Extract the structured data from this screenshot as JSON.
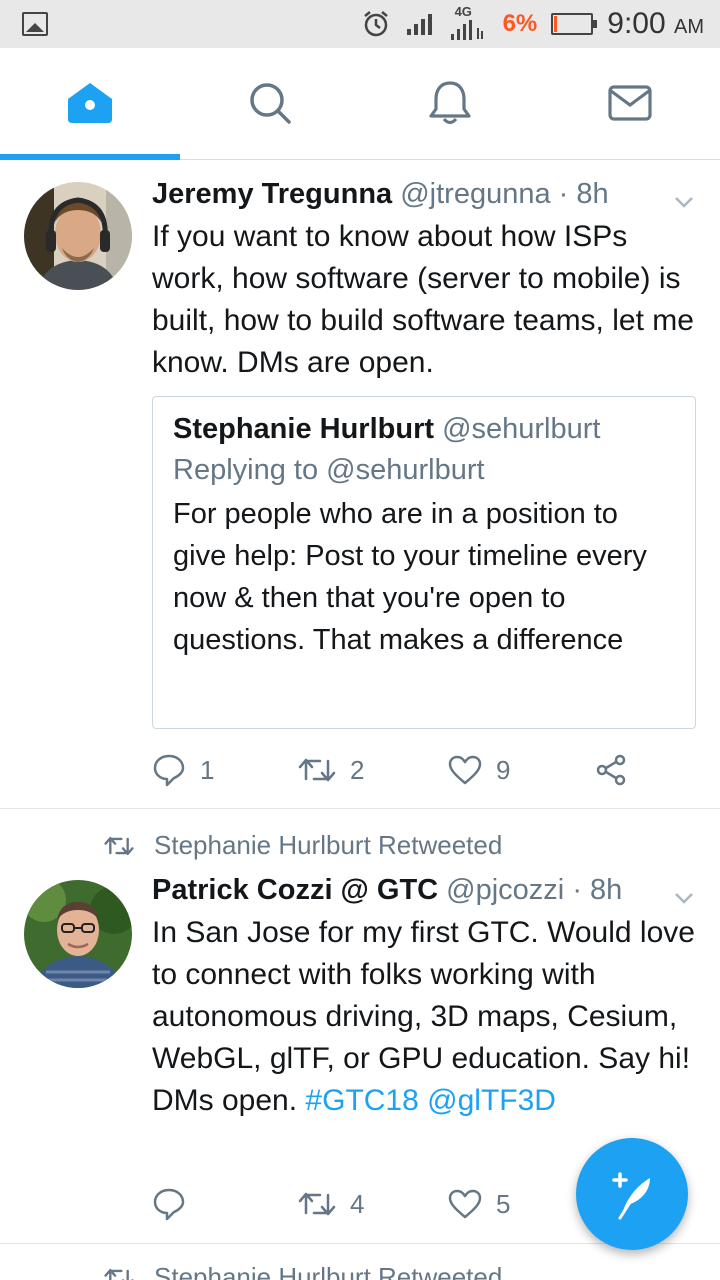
{
  "status_bar": {
    "network": "4G",
    "battery": "6%",
    "time": "9:00",
    "ampm": "AM"
  },
  "tabs": [
    {
      "name": "home",
      "icon": "home-icon",
      "active": true
    },
    {
      "name": "search",
      "icon": "search-icon",
      "active": false
    },
    {
      "name": "notifications",
      "icon": "bell-icon",
      "active": false
    },
    {
      "name": "messages",
      "icon": "envelope-icon",
      "active": false
    }
  ],
  "tweets": [
    {
      "name": "Jeremy Tregunna",
      "handle": "@jtregunna",
      "time": "· 8h",
      "text": "If you want to know about how ISPs work, how software (server to mobile) is built, how to build software teams, let me know. DMs are open.",
      "quote": {
        "name": "Stephanie Hurlburt",
        "handle": "@sehurlburt",
        "replying": "Replying to @sehurlburt",
        "text": "For people who are in a position to give help: Post to your timeline every now & then that you're open to questions. That makes a difference"
      },
      "replies": "1",
      "retweets": "2",
      "likes": "9"
    },
    {
      "social_context": "Stephanie Hurlburt Retweeted",
      "name": "Patrick Cozzi @ GTC",
      "handle": "@pjcozzi",
      "time": "· 8h",
      "text": "In San Jose for my first GTC. Would love to connect with folks working with autonomous driving, 3D maps, Cesium, WebGL, glTF, or GPU education. Say hi! DMs open.",
      "hashtag": "#GTC18",
      "mention": "@glTF3D",
      "replies": "",
      "retweets": "4",
      "likes": "5"
    }
  ],
  "next_social_context": "Stephanie Hurlburt Retweeted",
  "colors": {
    "accent": "#1da1f2",
    "muted": "#657786",
    "battery_low": "#ff5722"
  }
}
